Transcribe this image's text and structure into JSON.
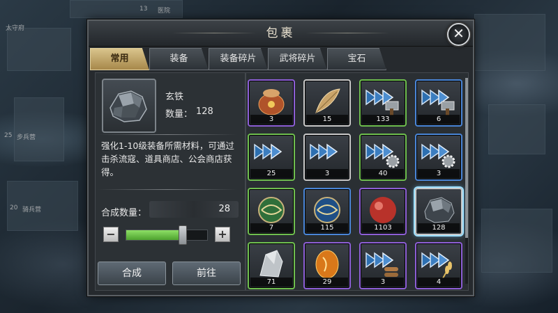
{
  "background": {
    "labels": [
      {
        "text": "13"
      },
      {
        "text": "医院"
      },
      {
        "text": "太守府"
      },
      {
        "text": "25"
      },
      {
        "text": "步兵营"
      },
      {
        "text": "20"
      },
      {
        "text": "骑兵营"
      }
    ]
  },
  "window": {
    "title": "包裹",
    "close_icon": "close-x"
  },
  "tabs": [
    {
      "label": "常用",
      "active": true
    },
    {
      "label": "装备",
      "active": false
    },
    {
      "label": "装备碎片",
      "active": false
    },
    {
      "label": "武将碎片",
      "active": false
    },
    {
      "label": "宝石",
      "active": false
    }
  ],
  "detail": {
    "item_icon": "xuantie-ore-icon",
    "name": "玄铁",
    "quantity_label": "数量：",
    "quantity_value": "128",
    "description": "强化1-10级装备所需材料，可通过击杀流寇、道具商店、公会商店获得。",
    "compose_label": "合成数量：",
    "compose_value": "28",
    "minus_label": "−",
    "plus_label": "+",
    "slider_level": 0.7,
    "compose_button": "合成",
    "goto_button": "前往"
  },
  "items": [
    {
      "count": "3",
      "quality": "purple",
      "icon": "money-bag-icon"
    },
    {
      "count": "15",
      "quality": "white",
      "icon": "leaf-icon"
    },
    {
      "count": "133",
      "quality": "green",
      "icon": "arrow-hammer-icon"
    },
    {
      "count": "6",
      "quality": "blue",
      "icon": "arrow-hammer-icon"
    },
    {
      "count": "25",
      "quality": "green",
      "icon": "arrow-icon"
    },
    {
      "count": "3",
      "quality": "white",
      "icon": "arrow-icon"
    },
    {
      "count": "40",
      "quality": "green",
      "icon": "arrow-gear-icon"
    },
    {
      "count": "3",
      "quality": "blue",
      "icon": "arrow-gear-icon"
    },
    {
      "count": "7",
      "quality": "green",
      "icon": "green-orb-icon"
    },
    {
      "count": "115",
      "quality": "blue",
      "icon": "blue-orb-icon"
    },
    {
      "count": "1103",
      "quality": "purple",
      "icon": "red-orb-icon"
    },
    {
      "count": "128",
      "quality": "white",
      "icon": "xuantie-ore-icon",
      "selected": true
    },
    {
      "count": "71",
      "quality": "green",
      "icon": "silver-ore-icon"
    },
    {
      "count": "29",
      "quality": "purple",
      "icon": "amber-stone-icon"
    },
    {
      "count": "3",
      "quality": "purple",
      "icon": "arrow-wood-icon"
    },
    {
      "count": "4",
      "quality": "purple",
      "icon": "arrow-wheat-icon"
    }
  ],
  "colors": {
    "purple": "#8d5fd6",
    "blue": "#4a86d8",
    "green": "#6fbf4f",
    "white": "#c9c9c9",
    "tab_active": "#d9c48c",
    "slider_fill": "#6cc54a"
  }
}
